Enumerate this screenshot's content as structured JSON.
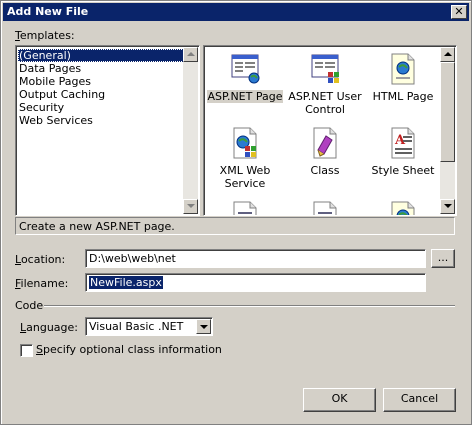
{
  "window": {
    "title": "Add New File",
    "close_symbol": "✕"
  },
  "templates": {
    "label": "Templates:",
    "categories": [
      {
        "label": "(General)",
        "selected": true
      },
      {
        "label": "Data Pages"
      },
      {
        "label": "Mobile Pages"
      },
      {
        "label": "Output Caching"
      },
      {
        "label": "Security"
      },
      {
        "label": "Web Services"
      }
    ],
    "items": [
      {
        "label": "ASP.NET Page",
        "icon": "aspnet-page-icon",
        "selected": true
      },
      {
        "label": "ASP.NET User Control",
        "icon": "user-control-icon"
      },
      {
        "label": "HTML Page",
        "icon": "html-page-icon"
      },
      {
        "label": "XML Web Service",
        "icon": "web-service-icon"
      },
      {
        "label": "Class",
        "icon": "class-icon"
      },
      {
        "label": "Style Sheet",
        "icon": "style-sheet-icon"
      }
    ]
  },
  "description": "Create a new ASP.NET page.",
  "location": {
    "label": "Location:",
    "value": "D:\\web\\web\\net",
    "browse_label": "..."
  },
  "filename": {
    "label": "Filename:",
    "value": "NewFile.aspx"
  },
  "code": {
    "group_label": "Code",
    "language_label": "Language:",
    "language_value": "Visual Basic .NET",
    "optional_class_label": "Specify optional class information",
    "optional_class_checked": false
  },
  "buttons": {
    "ok": "OK",
    "cancel": "Cancel"
  },
  "colors": {
    "title_bar": "#0a246a",
    "face": "#d4d0c8",
    "selection": "#0a246a"
  }
}
